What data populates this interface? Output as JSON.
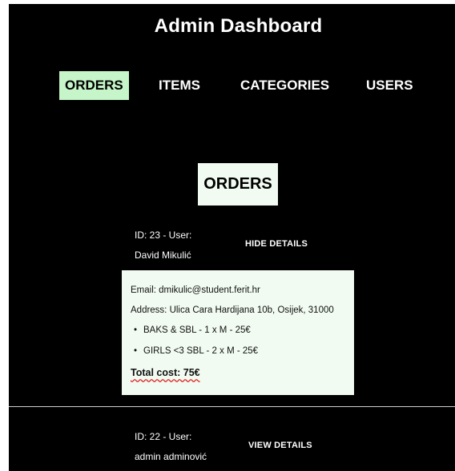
{
  "header": {
    "title": "Admin Dashboard"
  },
  "nav": {
    "items": [
      {
        "label": "ORDERS",
        "active": true
      },
      {
        "label": "ITEMS",
        "active": false
      },
      {
        "label": "CATEGORIES",
        "active": false
      },
      {
        "label": "USERS",
        "active": false
      }
    ]
  },
  "section": {
    "heading": "ORDERS"
  },
  "orders": [
    {
      "id_user": "ID: 23 - User:",
      "name": "David Mikulić",
      "toggle_label": "HIDE DETAILS",
      "expanded": true,
      "email": "Email: dmikulic@student.ferit.hr",
      "address": "Address: Ulica Cara Hardijana 10b, Osijek, 31000",
      "items": [
        "BAKS & SBL - 1 x M - 25€",
        "GIRLS <3 SBL - 2 x M - 25€"
      ],
      "total": "Total cost: 75€"
    },
    {
      "id_user": "ID: 22 - User:",
      "name": "admin adminović",
      "toggle_label": "VIEW DETAILS",
      "expanded": false
    }
  ],
  "colors": {
    "background": "#000000",
    "accent": "#c5f5c8",
    "panel": "#f1fbf1",
    "text": "#ffffff"
  }
}
